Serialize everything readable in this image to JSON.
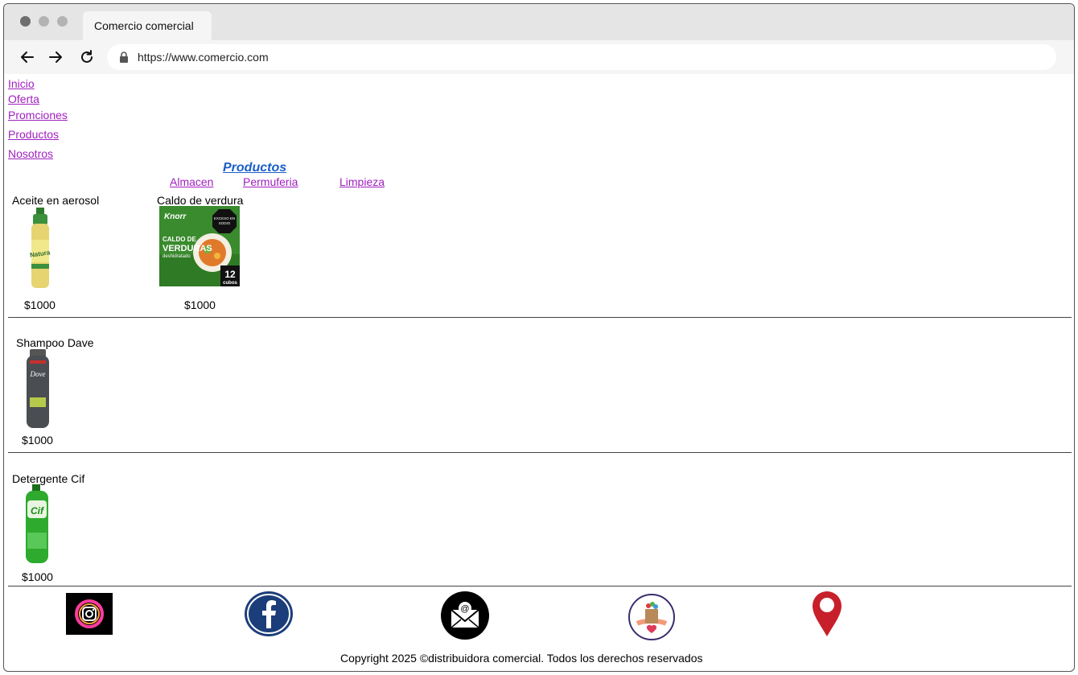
{
  "browser": {
    "tab_title": "Comercio comercial",
    "url": "https://www.comercio.com"
  },
  "nav": {
    "items": [
      "Inicio",
      "Oferta",
      "Promciones",
      "Productos",
      "Nosotros"
    ]
  },
  "products_section": {
    "title": "Productos",
    "categories": [
      "Almacen",
      "Permuferia",
      "Limpieza"
    ]
  },
  "products": [
    {
      "name": "Aceite en aerosol",
      "price": "$1000",
      "image_label": "Natura"
    },
    {
      "name": "Caldo de verdura",
      "price": "$1000",
      "image_label": "Knorr CALDO DE VERDURAS deshidratado 12 cubos"
    },
    {
      "name": "Shampoo Dave",
      "price": "$1000",
      "image_label": "Dove"
    },
    {
      "name": "Detergente Cif",
      "price": "$1000",
      "image_label": "Cif"
    }
  ],
  "footer": {
    "icons": [
      "instagram-icon",
      "facebook-icon",
      "email-icon",
      "store-logo-icon",
      "location-pin-icon"
    ],
    "copyright": "Copyright 2025 ©distribuidora comercial. Todos los derechos reservados"
  },
  "colors": {
    "link": "#a020c0",
    "title": "#1a5fc8",
    "facebook": "#1b3e7a",
    "pin": "#c8202a"
  }
}
